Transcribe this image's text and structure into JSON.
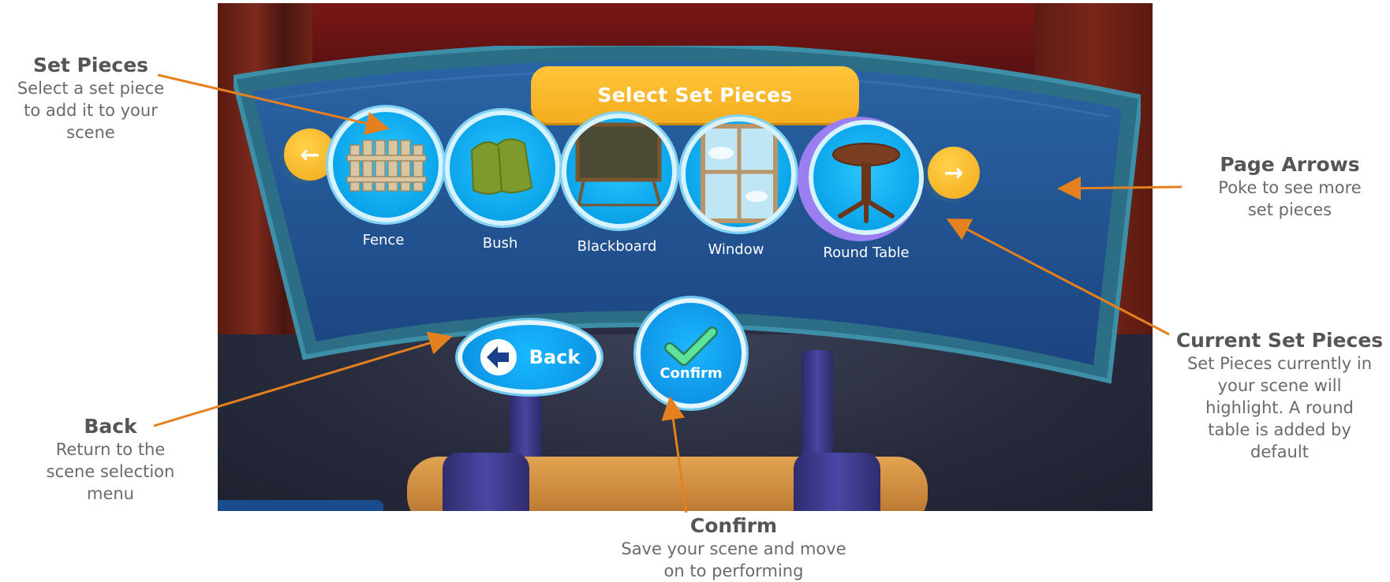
{
  "colors": {
    "accent_orange": "#e5801f",
    "panel_blue": "#1e4f8f",
    "title_yellow": "#f6b320",
    "highlight_purple": "#9b7ff0"
  },
  "panel": {
    "title": "Select Set Pieces",
    "prev_arrow_icon": "arrow-left-icon",
    "next_arrow_icon": "arrow-right-icon",
    "pieces": [
      {
        "label": "Fence",
        "icon": "fence-icon",
        "selected": false
      },
      {
        "label": "Bush",
        "icon": "bush-icon",
        "selected": false
      },
      {
        "label": "Blackboard",
        "icon": "blackboard-icon",
        "selected": false
      },
      {
        "label": "Window",
        "icon": "window-icon",
        "selected": false
      },
      {
        "label": "Round Table",
        "icon": "round-table-icon",
        "selected": true
      }
    ],
    "back_label": "Back",
    "confirm_label": "Confirm"
  },
  "annotations": {
    "set_pieces": {
      "title": "Set Pieces",
      "desc": [
        "Select a set piece",
        "to add it to your",
        "scene"
      ]
    },
    "back": {
      "title": "Back",
      "desc": [
        "Return to the",
        "scene selection",
        "menu"
      ]
    },
    "confirm": {
      "title": "Confirm",
      "desc": [
        "Save your scene and move",
        "on to performing"
      ]
    },
    "page_arrows": {
      "title": "Page Arrows",
      "desc": [
        "Poke to see more",
        "set pieces"
      ]
    },
    "current": {
      "title": "Current Set Pieces",
      "desc": [
        "Set Pieces currently in",
        "your scene will",
        "highlight. A round",
        "table is added by",
        "default"
      ]
    }
  }
}
